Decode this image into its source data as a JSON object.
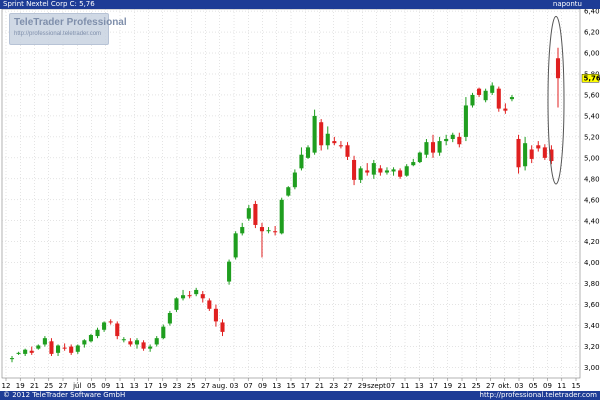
{
  "header": {
    "instrument": "Sprint Nextel Corp",
    "close_label": "C: 5,76",
    "period": "napontu"
  },
  "watermark": {
    "brand": "TeleTrader Professional",
    "url": "http://professional.teletrader.com"
  },
  "footer": {
    "copyright": "© 2012 TeleTrader Software GmbH",
    "url": "http://professional.teletrader.com"
  },
  "colors": {
    "up": "#1f9e1f",
    "down": "#e02020",
    "header_bg": "#1e3c96",
    "current_price_box": "#ffff00"
  },
  "chart_data": {
    "type": "candlestick",
    "title": "Sprint Nextel Corp",
    "xlabel": "",
    "ylabel": "",
    "ylim": [
      2.9,
      6.42
    ],
    "y_ticks": [
      "3,00",
      "3,20",
      "3,40",
      "3,60",
      "3,80",
      "4,00",
      "4,20",
      "4,40",
      "4,60",
      "4,80",
      "5,00",
      "5,20",
      "5,40",
      "5,60",
      "5,80",
      "6,00",
      "6,20",
      "6,40"
    ],
    "current_price": "5,76",
    "grid": "dotted",
    "x_tick_labels": [
      "12",
      "19",
      "21",
      "25",
      "27",
      "júl",
      "05",
      "09",
      "11",
      "13",
      "17",
      "19",
      "23",
      "25",
      "27",
      "aug.",
      "03",
      "07",
      "09",
      "13",
      "15",
      "17",
      "21",
      "23",
      "27",
      "29",
      "szept",
      "07",
      "11",
      "13",
      "17",
      "19",
      "21",
      "25",
      "27",
      "okt.",
      "03",
      "05",
      "09",
      "11",
      "15"
    ],
    "candles": [
      {
        "o": 3.08,
        "h": 3.11,
        "l": 3.05,
        "c": 3.09,
        "u": 1
      },
      {
        "o": 3.13,
        "h": 3.15,
        "l": 3.12,
        "c": 3.14,
        "u": 1
      },
      {
        "o": 3.13,
        "h": 3.18,
        "l": 3.11,
        "c": 3.17,
        "u": 1
      },
      {
        "o": 3.16,
        "h": 3.2,
        "l": 3.12,
        "c": 3.14,
        "u": 0
      },
      {
        "o": 3.18,
        "h": 3.22,
        "l": 3.17,
        "c": 3.21,
        "u": 1
      },
      {
        "o": 3.22,
        "h": 3.3,
        "l": 3.2,
        "c": 3.28,
        "u": 1
      },
      {
        "o": 3.25,
        "h": 3.28,
        "l": 3.11,
        "c": 3.13,
        "u": 0
      },
      {
        "o": 3.14,
        "h": 3.22,
        "l": 3.11,
        "c": 3.21,
        "u": 1
      },
      {
        "o": 3.19,
        "h": 3.23,
        "l": 3.16,
        "c": 3.18,
        "u": 0
      },
      {
        "o": 3.2,
        "h": 3.22,
        "l": 3.12,
        "c": 3.14,
        "u": 0
      },
      {
        "o": 3.15,
        "h": 3.22,
        "l": 3.13,
        "c": 3.21,
        "u": 1
      },
      {
        "o": 3.22,
        "h": 3.27,
        "l": 3.19,
        "c": 3.26,
        "u": 1
      },
      {
        "o": 3.25,
        "h": 3.32,
        "l": 3.24,
        "c": 3.31,
        "u": 1
      },
      {
        "o": 3.3,
        "h": 3.38,
        "l": 3.28,
        "c": 3.36,
        "u": 1
      },
      {
        "o": 3.36,
        "h": 3.44,
        "l": 3.34,
        "c": 3.43,
        "u": 1
      },
      {
        "o": 3.43,
        "h": 3.46,
        "l": 3.41,
        "c": 3.44,
        "u": 0
      },
      {
        "o": 3.42,
        "h": 3.44,
        "l": 3.27,
        "c": 3.3,
        "u": 0
      },
      {
        "o": 3.26,
        "h": 3.29,
        "l": 3.24,
        "c": 3.27,
        "u": 1
      },
      {
        "o": 3.25,
        "h": 3.28,
        "l": 3.2,
        "c": 3.22,
        "u": 0
      },
      {
        "o": 3.22,
        "h": 3.28,
        "l": 3.18,
        "c": 3.26,
        "u": 1
      },
      {
        "o": 3.24,
        "h": 3.26,
        "l": 3.16,
        "c": 3.18,
        "u": 0
      },
      {
        "o": 3.18,
        "h": 3.22,
        "l": 3.15,
        "c": 3.2,
        "u": 1
      },
      {
        "o": 3.22,
        "h": 3.3,
        "l": 3.2,
        "c": 3.28,
        "u": 1
      },
      {
        "o": 3.28,
        "h": 3.41,
        "l": 3.27,
        "c": 3.39,
        "u": 1
      },
      {
        "o": 3.42,
        "h": 3.54,
        "l": 3.4,
        "c": 3.52,
        "u": 1
      },
      {
        "o": 3.55,
        "h": 3.67,
        "l": 3.53,
        "c": 3.66,
        "u": 1
      },
      {
        "o": 3.66,
        "h": 3.74,
        "l": 3.64,
        "c": 3.69,
        "u": 1
      },
      {
        "o": 3.69,
        "h": 3.73,
        "l": 3.66,
        "c": 3.68,
        "u": 0
      },
      {
        "o": 3.7,
        "h": 3.76,
        "l": 3.68,
        "c": 3.74,
        "u": 1
      },
      {
        "o": 3.7,
        "h": 3.73,
        "l": 3.62,
        "c": 3.66,
        "u": 0
      },
      {
        "o": 3.64,
        "h": 3.66,
        "l": 3.54,
        "c": 3.56,
        "u": 0
      },
      {
        "o": 3.56,
        "h": 3.6,
        "l": 3.39,
        "c": 3.44,
        "u": 0
      },
      {
        "o": 3.43,
        "h": 3.46,
        "l": 3.3,
        "c": 3.34,
        "u": 0
      },
      {
        "o": 3.82,
        "h": 4.03,
        "l": 3.79,
        "c": 4.01,
        "u": 1
      },
      {
        "o": 4.05,
        "h": 4.3,
        "l": 4.03,
        "c": 4.28,
        "u": 1
      },
      {
        "o": 4.28,
        "h": 4.38,
        "l": 4.26,
        "c": 4.34,
        "u": 1
      },
      {
        "o": 4.42,
        "h": 4.55,
        "l": 4.4,
        "c": 4.52,
        "u": 1
      },
      {
        "o": 4.56,
        "h": 4.59,
        "l": 4.33,
        "c": 4.36,
        "u": 0
      },
      {
        "o": 4.34,
        "h": 4.38,
        "l": 4.05,
        "c": 4.3,
        "u": 0
      },
      {
        "o": 4.31,
        "h": 4.34,
        "l": 4.28,
        "c": 4.3,
        "u": 1
      },
      {
        "o": 4.3,
        "h": 4.35,
        "l": 4.26,
        "c": 4.29,
        "u": 0
      },
      {
        "o": 4.28,
        "h": 4.62,
        "l": 4.27,
        "c": 4.6,
        "u": 1
      },
      {
        "o": 4.64,
        "h": 4.73,
        "l": 4.63,
        "c": 4.72,
        "u": 1
      },
      {
        "o": 4.72,
        "h": 4.89,
        "l": 4.7,
        "c": 4.86,
        "u": 1
      },
      {
        "o": 4.9,
        "h": 5.1,
        "l": 4.88,
        "c": 5.03,
        "u": 1
      },
      {
        "o": 5.0,
        "h": 5.12,
        "l": 4.99,
        "c": 5.1,
        "u": 1
      },
      {
        "o": 5.05,
        "h": 5.46,
        "l": 5.03,
        "c": 5.4,
        "u": 1
      },
      {
        "o": 5.34,
        "h": 5.37,
        "l": 5.07,
        "c": 5.12,
        "u": 0
      },
      {
        "o": 5.12,
        "h": 5.3,
        "l": 5.08,
        "c": 5.23,
        "u": 1
      },
      {
        "o": 5.16,
        "h": 5.2,
        "l": 5.12,
        "c": 5.14,
        "u": 0
      },
      {
        "o": 5.12,
        "h": 5.16,
        "l": 5.09,
        "c": 5.11,
        "u": 0
      },
      {
        "o": 5.12,
        "h": 5.15,
        "l": 4.98,
        "c": 5.01,
        "u": 0
      },
      {
        "o": 4.98,
        "h": 5.02,
        "l": 4.74,
        "c": 4.79,
        "u": 0
      },
      {
        "o": 4.79,
        "h": 4.92,
        "l": 4.76,
        "c": 4.9,
        "u": 1
      },
      {
        "o": 4.88,
        "h": 4.95,
        "l": 4.83,
        "c": 4.86,
        "u": 0
      },
      {
        "o": 4.84,
        "h": 4.98,
        "l": 4.8,
        "c": 4.95,
        "u": 1
      },
      {
        "o": 4.9,
        "h": 4.93,
        "l": 4.83,
        "c": 4.86,
        "u": 0
      },
      {
        "o": 4.86,
        "h": 4.91,
        "l": 4.84,
        "c": 4.88,
        "u": 1
      },
      {
        "o": 4.87,
        "h": 4.91,
        "l": 4.83,
        "c": 4.89,
        "u": 1
      },
      {
        "o": 4.88,
        "h": 4.9,
        "l": 4.8,
        "c": 4.82,
        "u": 0
      },
      {
        "o": 4.83,
        "h": 4.94,
        "l": 4.82,
        "c": 4.92,
        "u": 1
      },
      {
        "o": 4.93,
        "h": 4.99,
        "l": 4.92,
        "c": 4.96,
        "u": 1
      },
      {
        "o": 4.96,
        "h": 5.06,
        "l": 4.95,
        "c": 5.05,
        "u": 1
      },
      {
        "o": 5.03,
        "h": 5.18,
        "l": 5.0,
        "c": 5.15,
        "u": 1
      },
      {
        "o": 5.15,
        "h": 5.22,
        "l": 5.0,
        "c": 5.05,
        "u": 0
      },
      {
        "o": 5.05,
        "h": 5.2,
        "l": 5.02,
        "c": 5.16,
        "u": 1
      },
      {
        "o": 5.16,
        "h": 5.22,
        "l": 5.12,
        "c": 5.18,
        "u": 1
      },
      {
        "o": 5.18,
        "h": 5.24,
        "l": 5.15,
        "c": 5.22,
        "u": 1
      },
      {
        "o": 5.2,
        "h": 5.24,
        "l": 5.1,
        "c": 5.13,
        "u": 0
      },
      {
        "o": 5.2,
        "h": 5.58,
        "l": 5.16,
        "c": 5.5,
        "u": 1
      },
      {
        "o": 5.5,
        "h": 5.62,
        "l": 5.48,
        "c": 5.6,
        "u": 1
      },
      {
        "o": 5.66,
        "h": 5.67,
        "l": 5.58,
        "c": 5.6,
        "u": 0
      },
      {
        "o": 5.55,
        "h": 5.66,
        "l": 5.53,
        "c": 5.64,
        "u": 1
      },
      {
        "o": 5.62,
        "h": 5.72,
        "l": 5.6,
        "c": 5.69,
        "u": 1
      },
      {
        "o": 5.66,
        "h": 5.68,
        "l": 5.44,
        "c": 5.47,
        "u": 0
      },
      {
        "o": 5.47,
        "h": 5.52,
        "l": 5.42,
        "c": 5.45,
        "u": 0
      },
      {
        "o": 5.56,
        "h": 5.6,
        "l": 5.54,
        "c": 5.58,
        "u": 1
      },
      {
        "o": 5.18,
        "h": 5.22,
        "l": 4.85,
        "c": 4.91,
        "u": 0
      },
      {
        "o": 4.92,
        "h": 5.2,
        "l": 4.88,
        "c": 5.14,
        "u": 1
      },
      {
        "o": 5.08,
        "h": 5.12,
        "l": 4.95,
        "c": 4.99,
        "u": 0
      },
      {
        "o": 5.12,
        "h": 5.16,
        "l": 5.06,
        "c": 5.09,
        "u": 0
      },
      {
        "o": 5.1,
        "h": 5.13,
        "l": 4.98,
        "c": 5.0,
        "u": 0
      },
      {
        "o": 5.08,
        "h": 5.12,
        "l": 4.94,
        "c": 4.97,
        "u": 0
      },
      {
        "o": 5.95,
        "h": 6.05,
        "l": 5.48,
        "c": 5.76,
        "u": 0
      }
    ]
  }
}
